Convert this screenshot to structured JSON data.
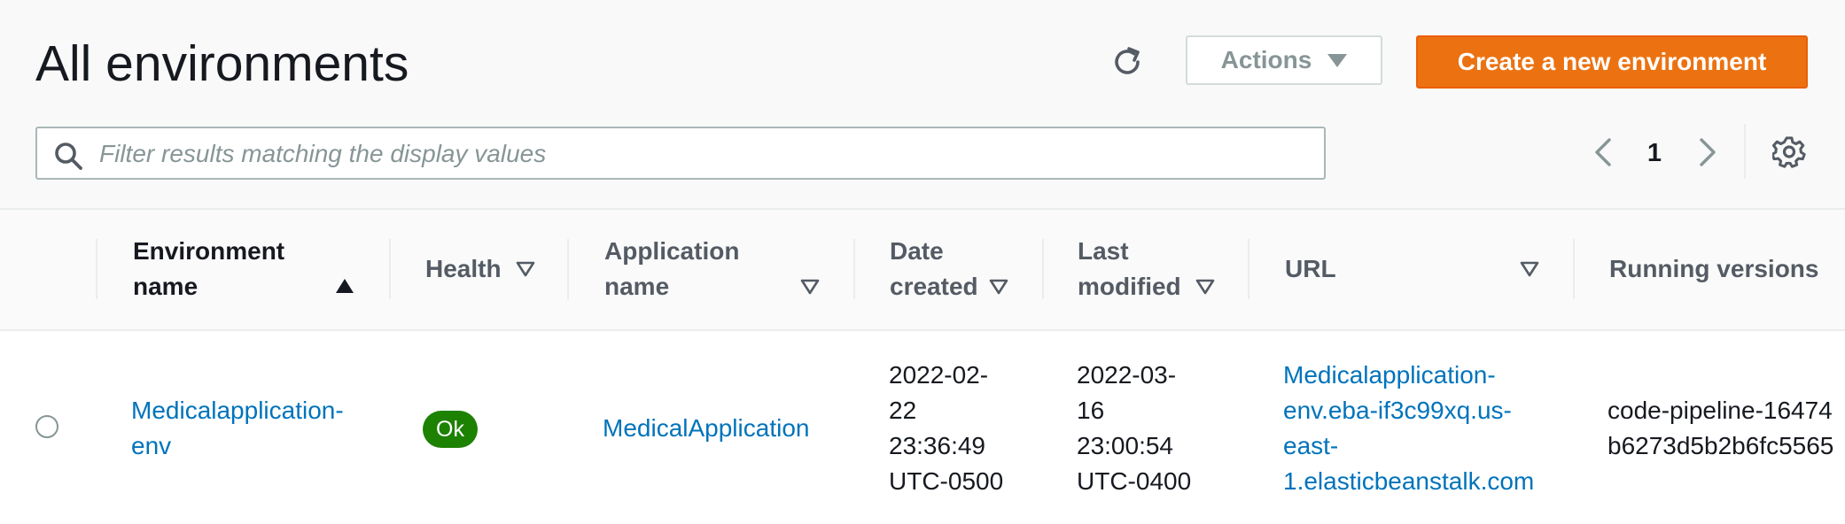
{
  "header": {
    "title": "All environments",
    "actions_label": "Actions",
    "create_label": "Create a new environment"
  },
  "search": {
    "placeholder": "Filter results matching the display values"
  },
  "pagination": {
    "current_page": "1"
  },
  "table": {
    "columns": {
      "env_name": [
        "Environment",
        "name"
      ],
      "health": "Health",
      "app_name": [
        "Application",
        "name"
      ],
      "date_created": [
        "Date",
        "created"
      ],
      "last_modified": [
        "Last",
        "modified"
      ],
      "url": "URL",
      "running_versions": "Running versions"
    },
    "rows": [
      {
        "env_name": [
          "Medicalapplication-",
          "env"
        ],
        "health": "Ok",
        "app_name": "MedicalApplication",
        "date_created": [
          "2022-02-",
          "22",
          "23:36:49",
          "UTC-0500"
        ],
        "last_modified": [
          "2022-03-",
          "16",
          "23:00:54",
          "UTC-0400"
        ],
        "url": [
          "Medicalapplication-",
          "env.eba-if3c99xq.us-",
          "east-",
          "1.elasticbeanstalk.com"
        ],
        "running_versions": [
          "code-pipeline-16474",
          "b6273d5b2b6fc5565"
        ]
      }
    ]
  },
  "colors": {
    "primary_button": "#ec7211",
    "link": "#0073bb",
    "status_ok": "#1d8102"
  },
  "icons": {
    "refresh": "refresh-icon",
    "search": "search-icon",
    "prev": "chevron-left-icon",
    "next": "chevron-right-icon",
    "settings": "gear-icon",
    "sort_asc": "sort-ascending-icon",
    "sort_none": "sort-descending-outline-icon"
  }
}
